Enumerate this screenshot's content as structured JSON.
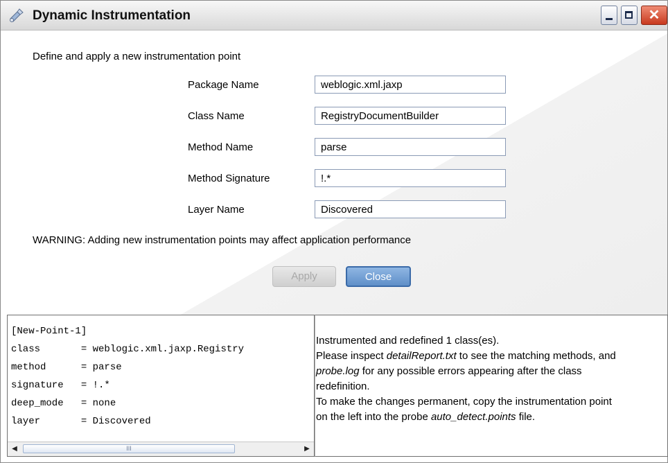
{
  "window": {
    "title": "Dynamic Instrumentation",
    "controls": {
      "minimize": "_",
      "maximize": "□",
      "close": "✕"
    }
  },
  "form": {
    "heading": "Define and apply a new instrumentation point",
    "fields": [
      {
        "label": "Package Name",
        "value": "weblogic.xml.jaxp"
      },
      {
        "label": "Class Name",
        "value": "RegistryDocumentBuilder"
      },
      {
        "label": "Method Name",
        "value": "parse"
      },
      {
        "label": "Method Signature",
        "value": "!.*"
      },
      {
        "label": "Layer Name",
        "value": "Discovered"
      }
    ],
    "warning": "WARNING: Adding new instrumentation points may affect application performance",
    "apply_label": "Apply",
    "close_label": "Close"
  },
  "point_text": {
    "lines": [
      "[New-Point-1]",
      "class       = weblogic.xml.jaxp.Registry",
      "method      = parse",
      "signature   = !.*",
      "deep_mode   = none",
      "layer       = Discovered"
    ],
    "scroll_thumb_grip": "III"
  },
  "message": {
    "line1": "Instrumented and redefined 1 class(es).",
    "line2_pre": "Please inspect ",
    "line2_file": "detailReport.txt",
    "line2_post": " to see the matching methods, and",
    "line3_file": "probe.log",
    "line3_post": " for any possible errors appearing after the class",
    "line4": "redefinition.",
    "line5": "To make the changes permanent, copy the instrumentation point",
    "line6_pre": "on the left into the probe ",
    "line6_file": "auto_detect.points",
    "line6_post": " file."
  },
  "colors": {
    "accent_button": "#5f8fc8",
    "close_button": "#c8391e"
  }
}
